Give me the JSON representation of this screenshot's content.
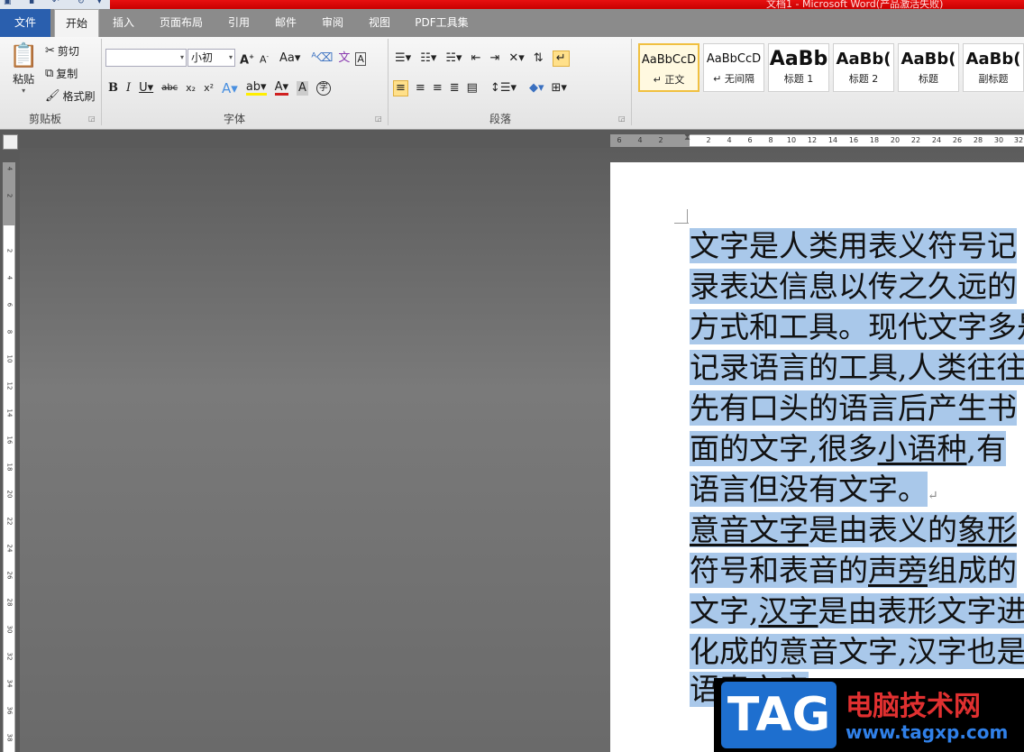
{
  "window": {
    "title": "文档1 - Microsoft Word(产品激活失败)"
  },
  "tabs": [
    "文件",
    "开始",
    "插入",
    "页面布局",
    "引用",
    "邮件",
    "审阅",
    "视图",
    "PDF工具集"
  ],
  "clipboard": {
    "paste": "粘贴",
    "cut": "剪切",
    "copy": "复制",
    "format_painter": "格式刷",
    "label": "剪贴板"
  },
  "font": {
    "name_value": "",
    "size_value": "小初",
    "label": "字体"
  },
  "paragraph": {
    "label": "段落"
  },
  "styles": [
    {
      "sample": "AaBbCcD",
      "name": "↵ 正文"
    },
    {
      "sample": "AaBbCcD",
      "name": "↵ 无间隔"
    },
    {
      "sample": "AaBb",
      "name": "标题 1"
    },
    {
      "sample": "AaBb(",
      "name": "标题 2"
    },
    {
      "sample": "AaBb(",
      "name": "标题"
    },
    {
      "sample": "AaBb(",
      "name": "副标题"
    }
  ],
  "hruler_numbers": [
    "6",
    "4",
    "2",
    "2",
    "4",
    "6",
    "8",
    "10",
    "12",
    "14",
    "16",
    "18",
    "20",
    "22",
    "24",
    "26",
    "28",
    "30",
    "32"
  ],
  "vruler_numbers": [
    "4",
    "2",
    "2",
    "4",
    "6",
    "8",
    "10",
    "12",
    "14",
    "16",
    "18",
    "20",
    "22",
    "24",
    "26",
    "28",
    "30",
    "32",
    "34",
    "36",
    "38"
  ],
  "document": {
    "lines": [
      [
        "文字是人类用表义符号记"
      ],
      [
        "录表达信息以传之久远的"
      ],
      [
        "方式和工具。现代文字多是"
      ],
      [
        "记录语言的工具,人类往往"
      ],
      [
        "先有口头的语言后产生书"
      ],
      [
        "面的文字,很多",
        "小语种",
        ",有"
      ],
      [
        "语言但没有文字。"
      ],
      [
        "意音文字",
        "是由表义的",
        "象形"
      ],
      [
        "符号和表音的",
        "声旁",
        "组成的"
      ],
      [
        "文字,",
        "汉字",
        "是由表形文字进"
      ],
      [
        "化成的意音文字,汉字也是"
      ],
      [
        "语素文字"
      ]
    ]
  },
  "watermark": {
    "badge": "TAG",
    "site_name": "电脑技术网",
    "url": "www.tagxp.com"
  },
  "colors": {
    "selection": "#a9c8ea",
    "file_tab": "#2a5fae",
    "title_bar": "#e81010"
  }
}
